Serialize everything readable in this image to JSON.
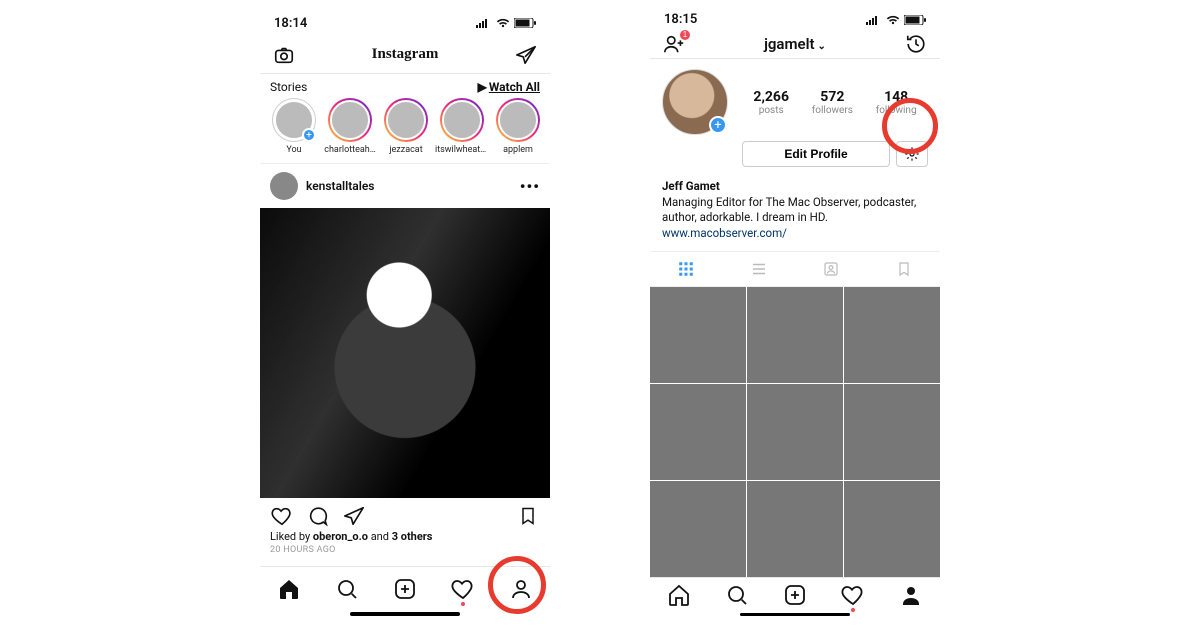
{
  "left": {
    "status": {
      "time": "18:14"
    },
    "topbar": {
      "title": "Instagram"
    },
    "stories": {
      "header": "Stories",
      "watch_all": "Watch All",
      "items": [
        {
          "label": "You"
        },
        {
          "label": "charlotteah…"
        },
        {
          "label": "jezzacat"
        },
        {
          "label": "itswilwheaton"
        },
        {
          "label": "applem"
        }
      ]
    },
    "post": {
      "author": "kenstalltales",
      "liked_prefix": "Liked by ",
      "liked_user": "oberon_o.o",
      "liked_mid": " and ",
      "liked_others": "3 others",
      "timestamp": "20 HOURS AGO"
    },
    "tabs": {
      "activity_badge": true
    }
  },
  "right": {
    "status": {
      "time": "18:15"
    },
    "topbar": {
      "username": "jgamelt",
      "badge": "1"
    },
    "profile": {
      "stats": {
        "posts": {
          "n": "2,266",
          "l": "posts"
        },
        "followers": {
          "n": "572",
          "l": "followers"
        },
        "following": {
          "n": "148",
          "l": "following"
        }
      },
      "edit_label": "Edit Profile",
      "name": "Jeff Gamet",
      "bio": "Managing Editor for The Mac Observer, podcaster, author, adorkable. I dream in HD.",
      "link": "www.macobserver.com/"
    },
    "grid_count": 9
  }
}
